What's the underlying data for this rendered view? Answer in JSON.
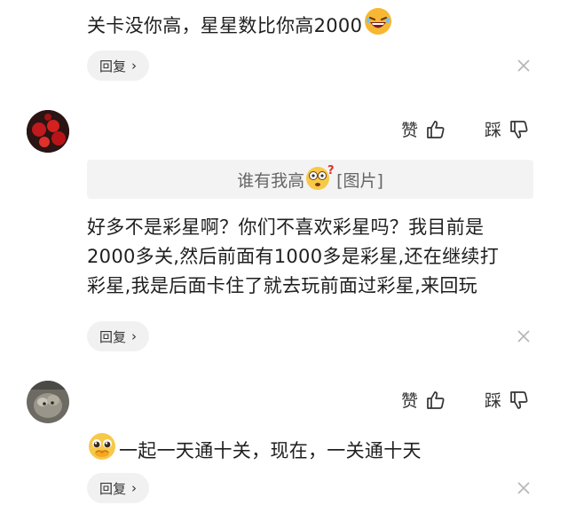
{
  "comment_top": {
    "text": "关卡没你高，星星数比你高2000",
    "emoji": "laughing-face-icon",
    "reply_label": "回复"
  },
  "comment_1": {
    "like_label": "赞",
    "dislike_label": "踩",
    "quote_text": "谁有我高",
    "quote_emoji": "confused-face-icon",
    "quote_suffix": "[图片]",
    "text": "好多不是彩星啊？你们不喜欢彩星吗？我目前是2000多关,然后前面有1000多是彩星,还在继续打彩星,我是后面卡住了就去玩前面过彩星,来回玩",
    "lines": [
      "好多不是彩星啊？你们不喜欢彩星吗？我目前是",
      "2000多关,然后前面有1000多是彩星,还在继续打",
      "彩星,我是后面卡住了就去玩前面过彩星,来回玩"
    ],
    "reply_label": "回复"
  },
  "comment_2": {
    "like_label": "赞",
    "dislike_label": "踩",
    "emoji": "pleading-face-icon",
    "text": "一起一天通十关，现在，一关通十天",
    "reply_label": "回复"
  },
  "colors": {
    "text": "#1f1f1f",
    "reply_bg": "#f1f1f1",
    "quote_bg": "#f3f3f3",
    "muted": "#b5b5b5"
  }
}
